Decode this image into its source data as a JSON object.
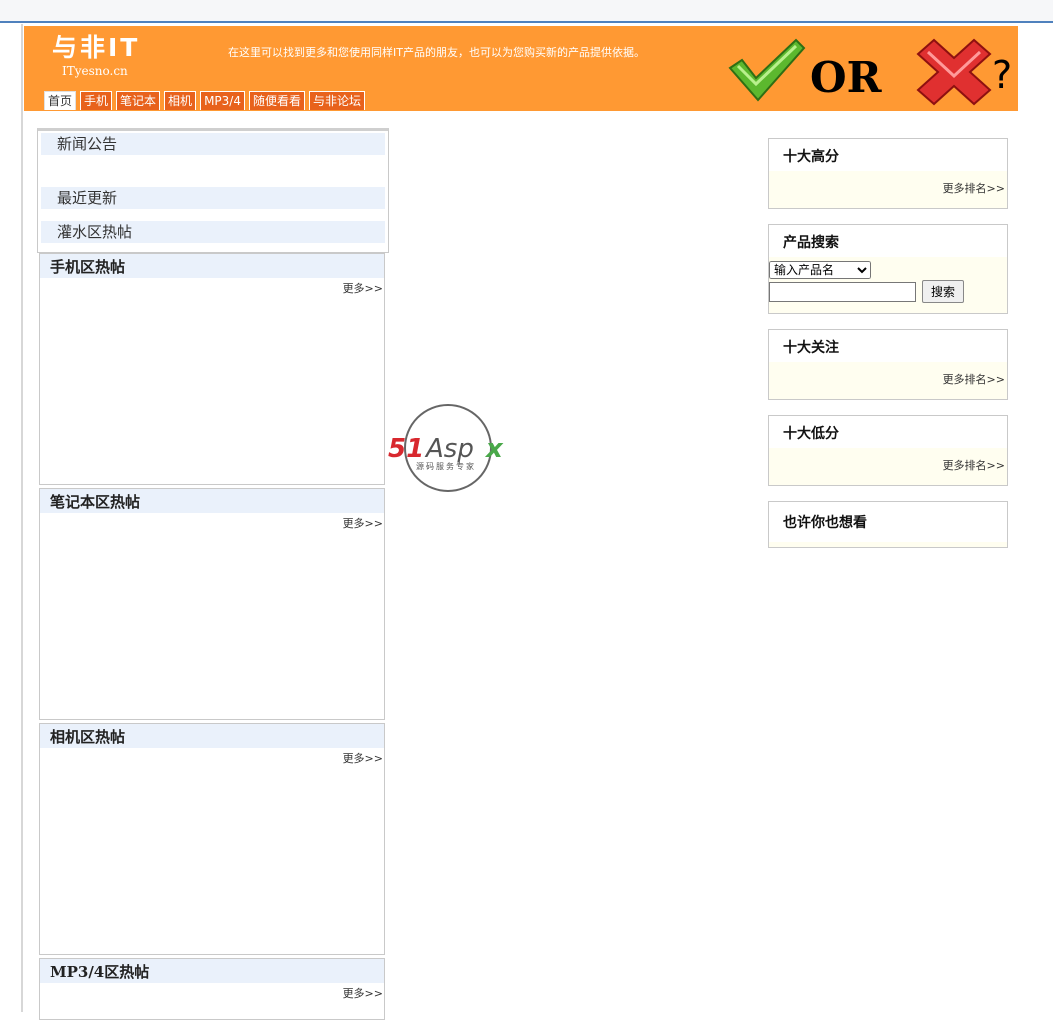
{
  "header": {
    "logo_cn": "与非IT",
    "logo_en": "ITyesno.cn",
    "tagline": "在这里可以找到更多和您使用同样IT产品的朋友，也可以为您购买新的产品提供依据。",
    "banner_or_text": "OR",
    "banner_question": "?",
    "nav": [
      "首页",
      "手机",
      "笔记本",
      "相机",
      "MP3/4",
      "随便看看",
      "与非论坛"
    ]
  },
  "news": {
    "announcement": "新闻公告",
    "latest": "最近更新",
    "water_hot": "灌水区热帖"
  },
  "hot_boxes": [
    {
      "title": "手机区热帖",
      "more": "更多>>"
    },
    {
      "title": "笔记本区热帖",
      "more": "更多>>"
    },
    {
      "title": "相机区热帖",
      "more": "更多>>"
    },
    {
      "title": "MP3/4区热帖",
      "more": "更多>>"
    }
  ],
  "sidebar": {
    "top_ten_high": {
      "title": "十大高分",
      "more": "更多排名>>"
    },
    "product_search": {
      "title": "产品搜索",
      "select_value": "输入产品名",
      "button": "搜索"
    },
    "top_ten_follow": {
      "title": "十大关注",
      "more": "更多排名>>"
    },
    "top_ten_low": {
      "title": "十大低分",
      "more": "更多排名>>"
    },
    "maybe_like": {
      "title": "也许你也想看"
    }
  },
  "watermark": {
    "brand": "51Aspx",
    "slogan": "源码服务专家"
  },
  "colors": {
    "header_bg": "#ff9933",
    "nav_bg": "#e8621c",
    "row_bg": "#eaf1fb",
    "side_bg": "#fffef0"
  }
}
